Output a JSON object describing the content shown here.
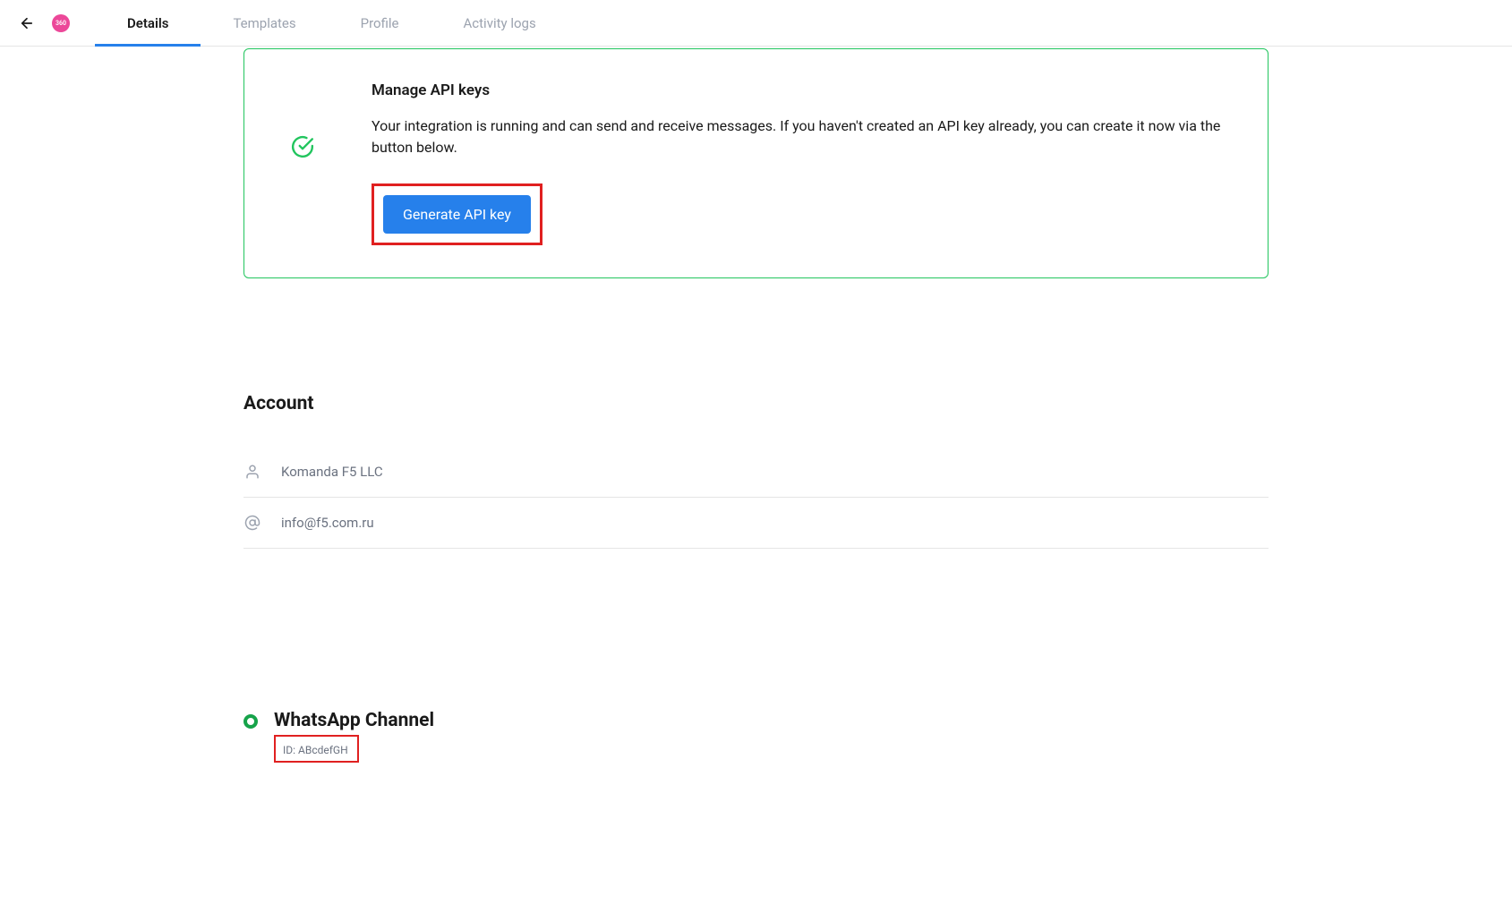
{
  "logo": {
    "text": "360"
  },
  "tabs": [
    {
      "label": "Details",
      "active": true
    },
    {
      "label": "Templates",
      "active": false
    },
    {
      "label": "Profile",
      "active": false
    },
    {
      "label": "Activity logs",
      "active": false
    }
  ],
  "api_card": {
    "title": "Manage API keys",
    "description": "Your integration is running and can send and receive messages. If you haven't created an API key already, you can create it now via the button below.",
    "button_label": "Generate API key"
  },
  "account": {
    "heading": "Account",
    "company": "Komanda F5 LLC",
    "email": "info@f5.com.ru"
  },
  "channel": {
    "title": "WhatsApp Channel",
    "id_label": "ID: ABcdefGH"
  }
}
